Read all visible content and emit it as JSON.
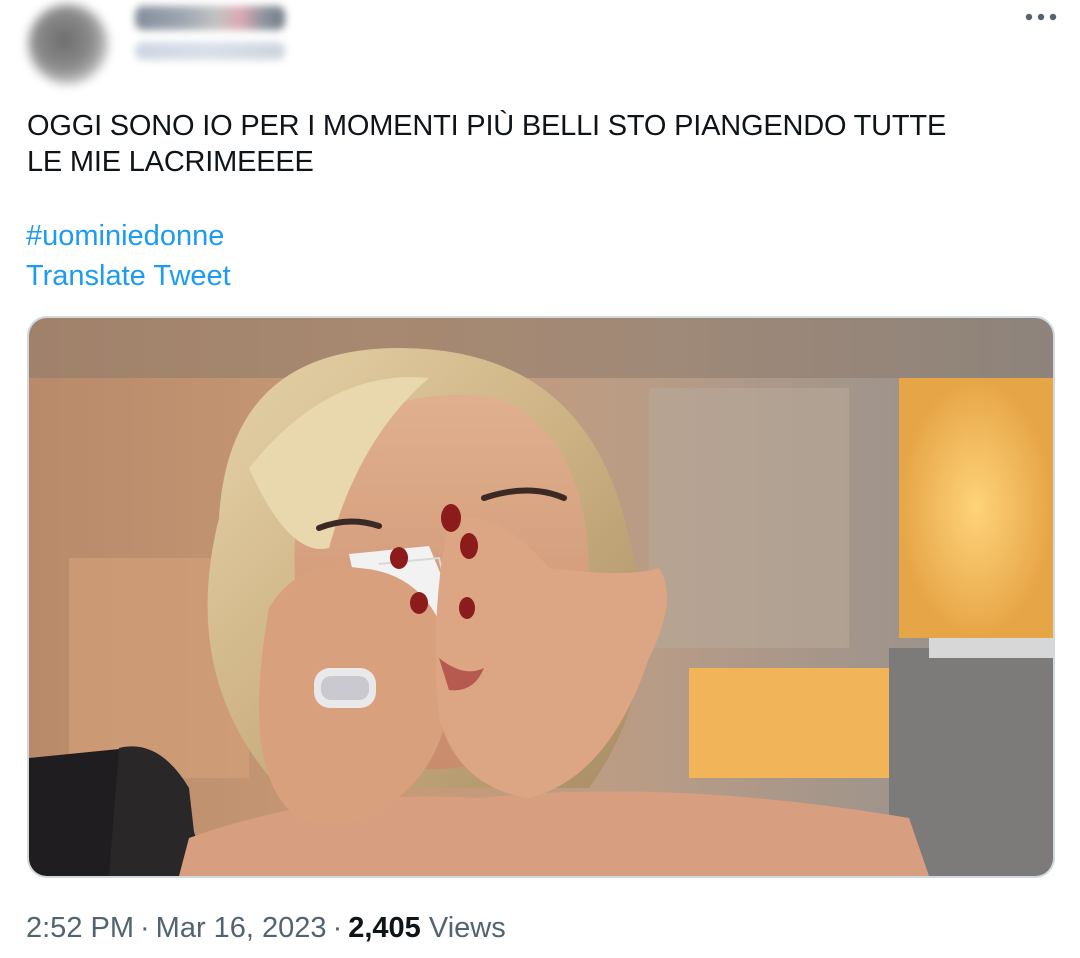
{
  "tweet": {
    "text": "OGGI SONO IO PER I MOMENTI PIÙ BELLI STO PIANGENDO TUTTE\nLE MIE LACRIMEEEE",
    "hashtag": "#uominiedonne",
    "translate_label": "Translate Tweet",
    "more_icon": "ellipsis-icon",
    "media_description_icon": "photo"
  },
  "meta": {
    "time": "2:52 PM",
    "separator": "·",
    "date": "Mar 16, 2023",
    "views_count": "2,405",
    "views_label": "Views"
  },
  "colors": {
    "link": "#1d9bf0",
    "text": "#0f1419",
    "secondary": "#536471",
    "border": "#cfd9de"
  }
}
